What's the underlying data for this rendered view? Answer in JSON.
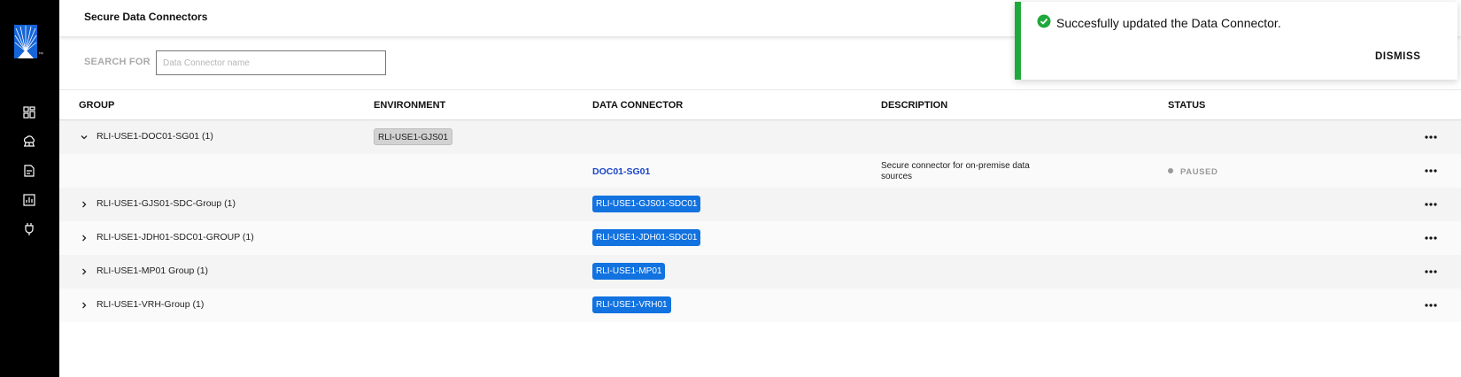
{
  "header": {
    "title": "Secure Data Connectors"
  },
  "search": {
    "label": "SEARCH FOR",
    "placeholder": "Data Connector name",
    "value": ""
  },
  "sidebar": {
    "logo_tm": "™",
    "items": [
      {
        "icon": "dashboard-icon"
      },
      {
        "icon": "cloud-network-icon"
      },
      {
        "icon": "document-icon"
      },
      {
        "icon": "report-chart-icon"
      },
      {
        "icon": "plug-icon"
      }
    ]
  },
  "table": {
    "columns": [
      "GROUP",
      "ENVIRONMENT",
      "DATA CONNECTOR",
      "DESCRIPTION",
      "STATUS"
    ],
    "rows": [
      {
        "expanded": true,
        "group": "RLI-USE1-DOC01-SG01 (1)",
        "environment": "RLI-USE1-GJS01",
        "connector": "",
        "description": "",
        "status": ""
      },
      {
        "child": true,
        "group": "",
        "environment": "",
        "connector": "DOC01-SG01",
        "description": "Secure connector for on-premise data sources",
        "status": "PAUSED"
      },
      {
        "expanded": false,
        "group": "RLI-USE1-GJS01-SDC-Group (1)",
        "environment": "",
        "connector": "RLI-USE1-GJS01-SDC01",
        "description": "",
        "status": ""
      },
      {
        "expanded": false,
        "group": "RLI-USE1-JDH01-SDC01-GROUP (1)",
        "environment": "",
        "connector": "RLI-USE1-JDH01-SDC01",
        "description": "",
        "status": ""
      },
      {
        "expanded": false,
        "group": "RLI-USE1-MP01 Group (1)",
        "environment": "",
        "connector": "RLI-USE1-MP01",
        "description": "",
        "status": ""
      },
      {
        "expanded": false,
        "group": "RLI-USE1-VRH-Group (1)",
        "environment": "",
        "connector": "RLI-USE1-VRH01",
        "description": "",
        "status": ""
      }
    ]
  },
  "toast": {
    "message": "Succesfully updated the Data Connector.",
    "dismiss": "DISMISS",
    "accent": "#1fa83b"
  },
  "colors": {
    "sidebar": "#000000",
    "brand_blue": "#1565d8",
    "tag_blue": "#1172e0",
    "link_blue": "#1a45c8"
  }
}
